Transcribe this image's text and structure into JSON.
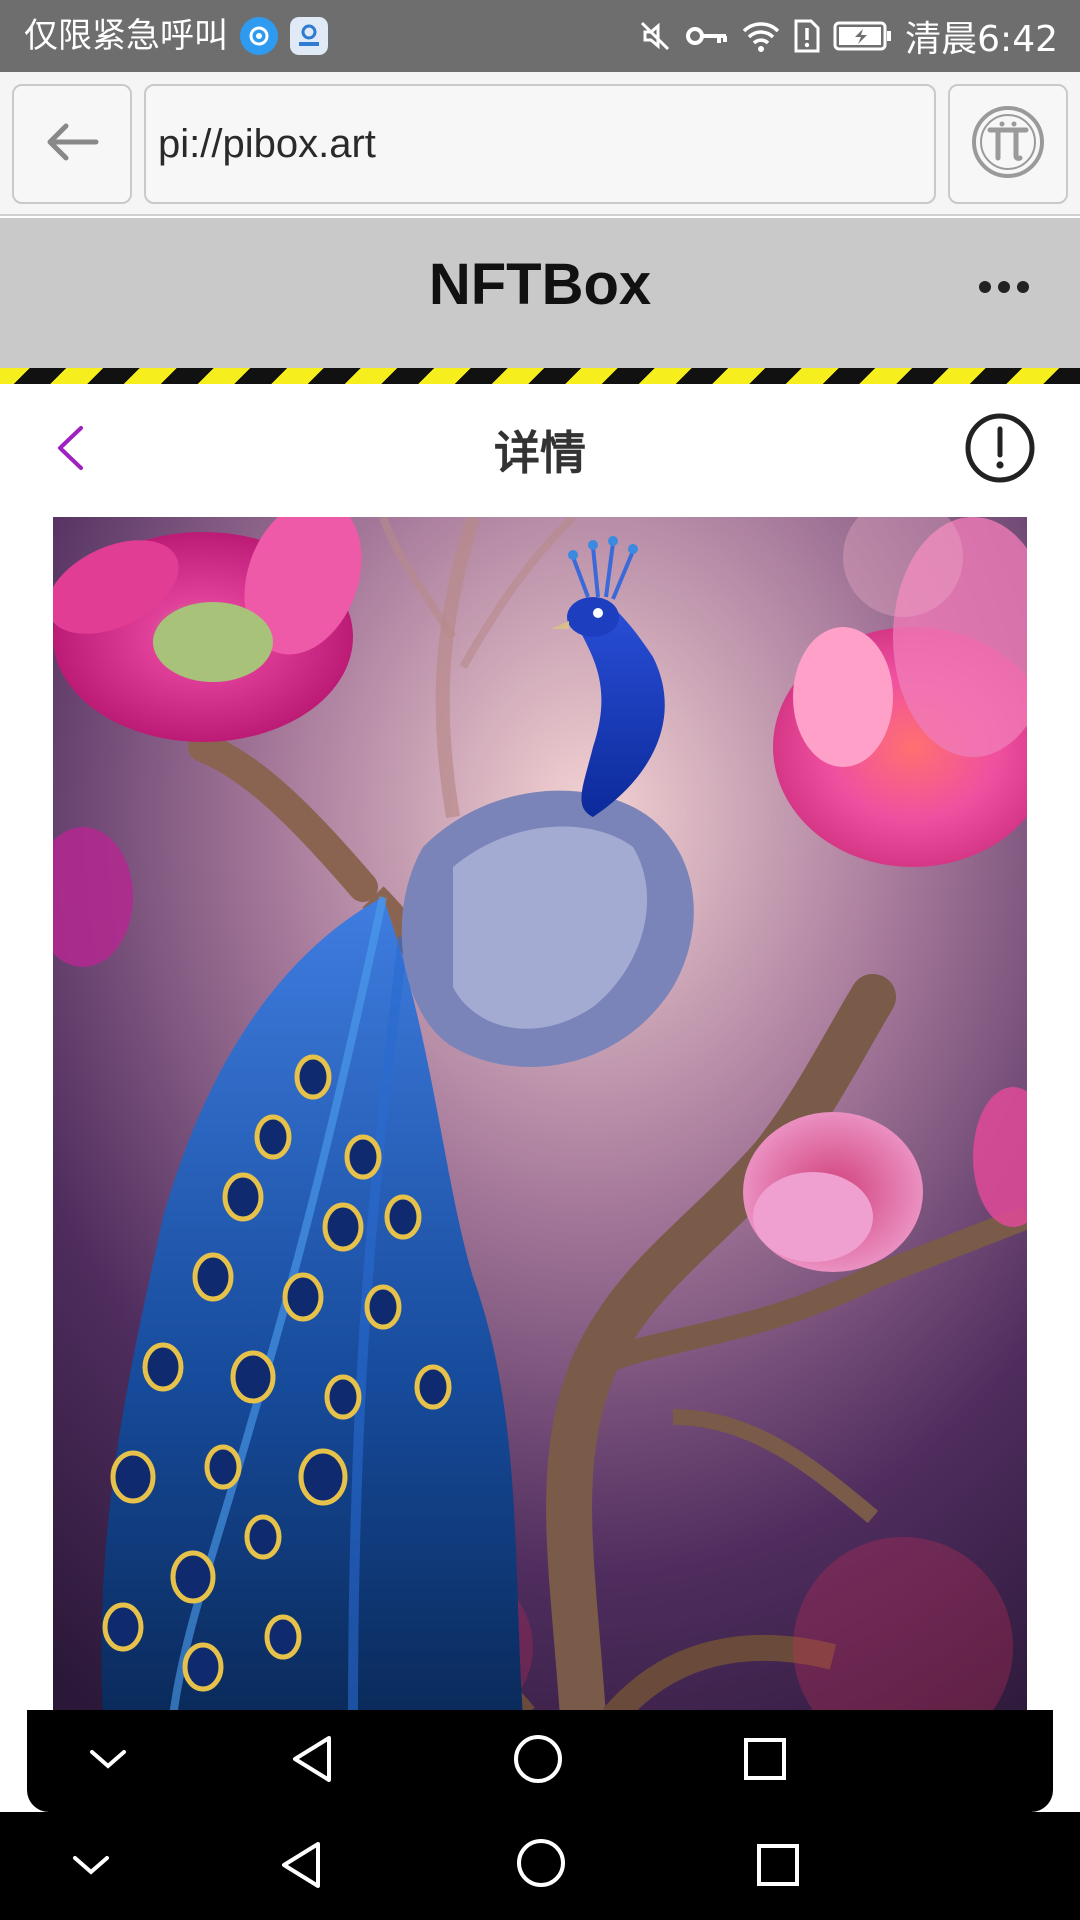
{
  "status_bar": {
    "carrier_text": "仅限紧急呼叫",
    "time": "清晨6:42",
    "icons": [
      "app-badge-swirl-icon",
      "app-badge-contact-icon",
      "mute-icon",
      "key-icon",
      "wifi-icon",
      "sim-alert-icon",
      "battery-charging-icon"
    ]
  },
  "browser": {
    "url": "pi://pibox.art",
    "back_icon": "arrow-left-icon",
    "pi_icon": "pi-logo-icon"
  },
  "app_header": {
    "title": "NFTBox",
    "more_icon": "more-dots-icon"
  },
  "detail": {
    "title": "详情",
    "back_icon": "chevron-left-icon",
    "info_icon": "info-exclamation-icon",
    "accent_color": "#a020c0"
  },
  "artwork": {
    "subject": "peacock-on-branch-artwork"
  },
  "nav": {
    "floating": [
      "collapse-icon",
      "back-triangle-icon",
      "home-circle-icon",
      "recents-square-icon"
    ],
    "system": [
      "collapse-icon",
      "back-triangle-icon",
      "home-circle-icon",
      "recents-square-icon"
    ]
  },
  "colors": {
    "status_bar": "#6e6e6e",
    "browser_bar": "#f5f5f5",
    "app_header": "#c9c9c9",
    "hazard_yellow": "#f6ee1d",
    "hazard_black": "#111111"
  }
}
